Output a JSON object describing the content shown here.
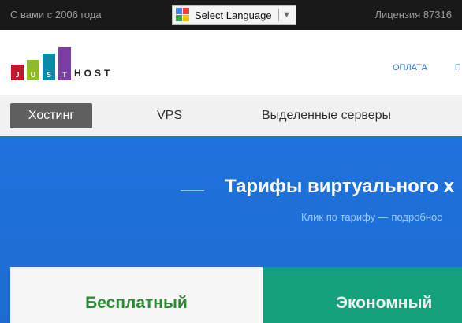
{
  "topbar": {
    "since": "С вами с 2006 года",
    "license": "Лицензия 87316",
    "language": {
      "label": "Select Language",
      "arrow": "▼",
      "icon": "google-translate-icon"
    }
  },
  "header": {
    "logo": {
      "letters": [
        "J",
        "U",
        "S",
        "T"
      ],
      "host": "HOST",
      "colors": [
        "#c0182c",
        "#8dbb2b",
        "#0b8aa7",
        "#7a3fa1"
      ]
    },
    "nav": [
      "ОПЛАТА",
      "П"
    ]
  },
  "tabs": [
    {
      "label": "Хостинг",
      "active": true
    },
    {
      "label": "VPS",
      "active": false
    },
    {
      "label": "Выделенные серверы",
      "active": false
    }
  ],
  "hero": {
    "title": "Тарифы виртуального х",
    "subtitle": "Клик по тарифу — подробнос"
  },
  "plans": [
    {
      "name": "Бесплатный"
    },
    {
      "name": "Экономный"
    }
  ]
}
